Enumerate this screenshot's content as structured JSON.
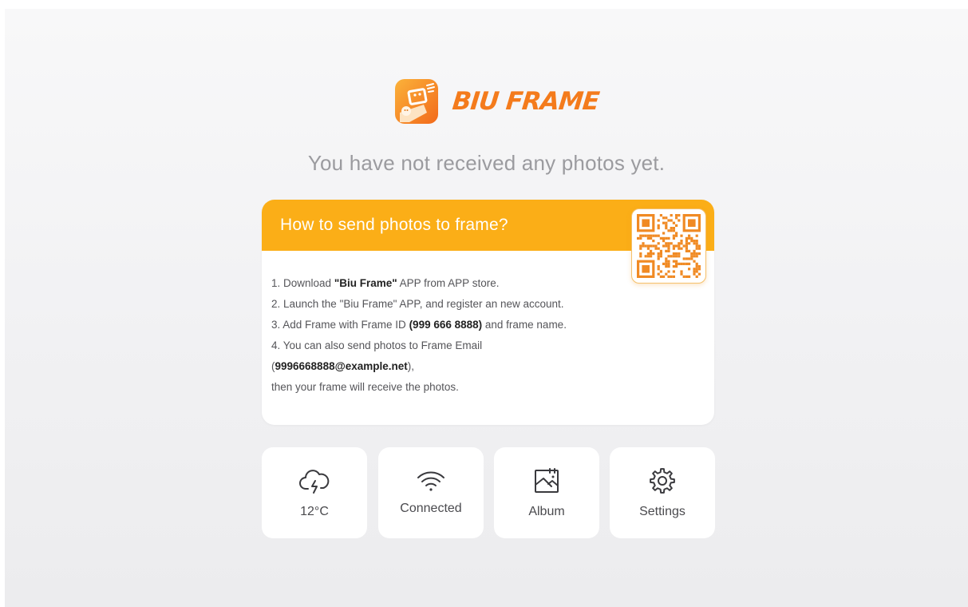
{
  "brand": {
    "name": "BIU FRAME",
    "accent_color": "#f47b1c",
    "logo_icon": "frame-app-logo-icon"
  },
  "empty_message": "You have not received any photos yet.",
  "instructions": {
    "title": "How to send photos to frame?",
    "header_color": "#fbae17",
    "qr_icon": "qr-code-icon",
    "steps": {
      "s1_prefix": "1. Download ",
      "s1_app": "\"Biu Frame\"",
      "s1_suffix": " APP from APP store.",
      "s2": "2. Launch the \"Biu Frame\" APP, and register an new account.",
      "s3_prefix": "3. Add Frame with Frame ID ",
      "s3_id": "(999 666 8888)",
      "s3_suffix": " and frame name.",
      "s4": "4. You can also send photos to Frame Email",
      "s4_open": "(",
      "s4_email": "9996668888@example.net",
      "s4_close": "),",
      "s4_end": "then your frame will receive the photos."
    }
  },
  "tiles": [
    {
      "icon": "cloud-lightning-icon",
      "label": "12°C"
    },
    {
      "icon": "wifi-icon",
      "label": "Connected"
    },
    {
      "icon": "album-icon",
      "label": "Album"
    },
    {
      "icon": "gear-icon",
      "label": "Settings"
    }
  ]
}
